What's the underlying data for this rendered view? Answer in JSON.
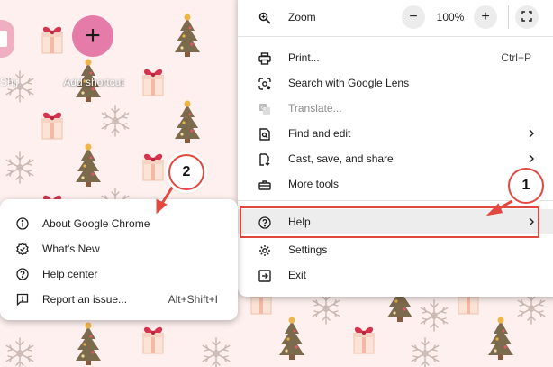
{
  "new_tab": {
    "add_shortcut_label": "Add shortcut",
    "partial_shortcut_label": "Ship"
  },
  "menu": {
    "zoom": {
      "label": "Zoom",
      "value": "100%",
      "minus": "−",
      "plus": "+"
    },
    "items": [
      {
        "label": "Print...",
        "shortcut": "Ctrl+P"
      },
      {
        "label": "Search with Google Lens"
      },
      {
        "label": "Translate..."
      },
      {
        "label": "Find and edit"
      },
      {
        "label": "Cast, save, and share"
      },
      {
        "label": "More tools"
      },
      {
        "label": "Help"
      },
      {
        "label": "Settings"
      },
      {
        "label": "Exit"
      }
    ]
  },
  "help_submenu": {
    "items": [
      {
        "label": "About Google Chrome"
      },
      {
        "label": "What's New"
      },
      {
        "label": "Help center"
      },
      {
        "label": "Report an issue...",
        "shortcut": "Alt+Shift+I"
      }
    ]
  },
  "annotations": {
    "badge_1": "1",
    "badge_2": "2"
  },
  "colors": {
    "annotation": "#e2483f",
    "background": "#fdf0ee",
    "add_button": "#e57ba9",
    "highlight_row": "#ededed"
  },
  "icons": [
    "zoom-icon",
    "fullscreen-icon",
    "print-icon",
    "google-lens-icon",
    "translate-icon",
    "find-edit-icon",
    "cast-save-share-icon",
    "more-tools-icon",
    "help-icon",
    "settings-icon",
    "exit-icon",
    "info-icon",
    "whats-new-icon",
    "help-center-icon",
    "report-issue-icon",
    "chevron-right-icon"
  ]
}
